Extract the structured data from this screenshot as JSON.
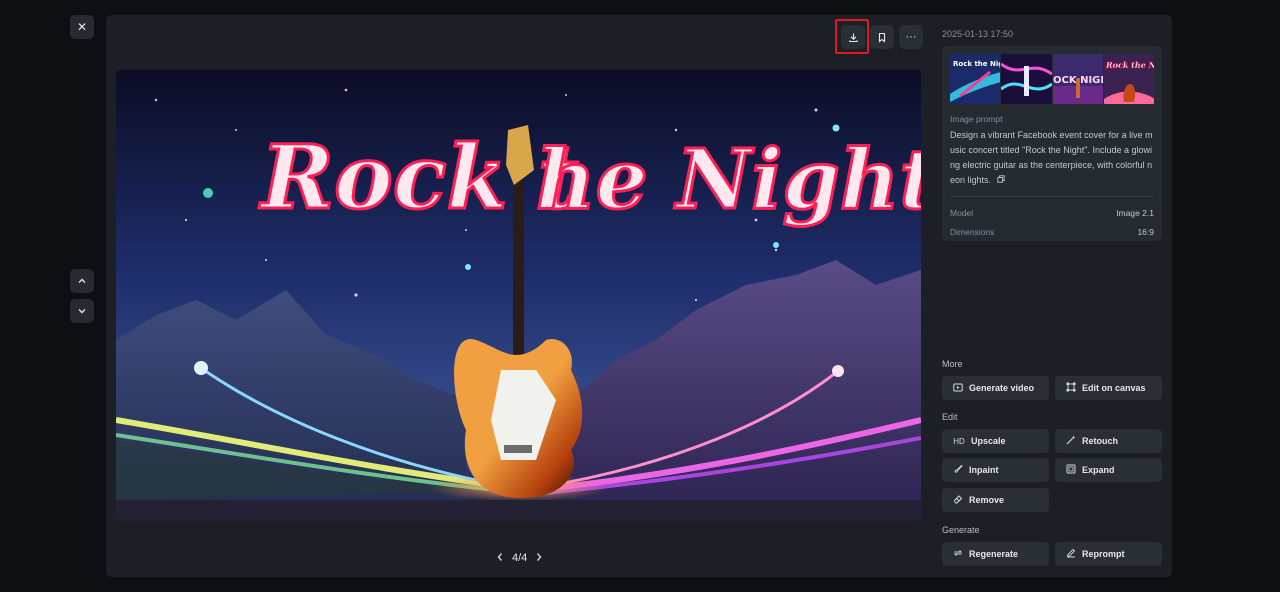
{
  "viewer": {
    "close_icon": "close-icon",
    "nav_up_icon": "chevron-up-icon",
    "nav_down_icon": "chevron-down-icon"
  },
  "toolbar": {
    "download_icon": "download-icon",
    "bookmark_icon": "bookmark-icon",
    "more_icon": "more-horizontal-icon"
  },
  "image": {
    "title_left": "Rock t",
    "title_right": "he Night"
  },
  "pager": {
    "current": "4/4"
  },
  "side": {
    "timestamp": "2025-01-13 17:50",
    "thumbnails": [
      {
        "text": "Rock the Night"
      },
      {
        "text": ""
      },
      {
        "text": "OCK NIGH"
      },
      {
        "text": "Rock the Night"
      }
    ],
    "prompt_label": "Image prompt",
    "prompt_text": "Design a vibrant Facebook event cover for a live music concert titled \"Rock the Night\". Include a glowing electric guitar as the centerpiece, with colorful neon lights.",
    "copy_icon": "copy-icon",
    "model_label": "Model",
    "model_value": "Image 2.1",
    "dimensions_label": "Dimensions",
    "dimensions_value": "16:9"
  },
  "sections": {
    "more": "More",
    "edit": "Edit",
    "generate": "Generate"
  },
  "actions": {
    "generate_video": "Generate video",
    "edit_on_canvas": "Edit on canvas",
    "upscale": "Upscale",
    "upscale_icon_text": "HD",
    "retouch": "Retouch",
    "inpaint": "Inpaint",
    "expand": "Expand",
    "remove": "Remove",
    "regenerate": "Regenerate",
    "reprompt": "Reprompt"
  },
  "colors": {
    "highlight": "#e4161f",
    "panel": "#1c1f25",
    "card": "#262a31"
  }
}
